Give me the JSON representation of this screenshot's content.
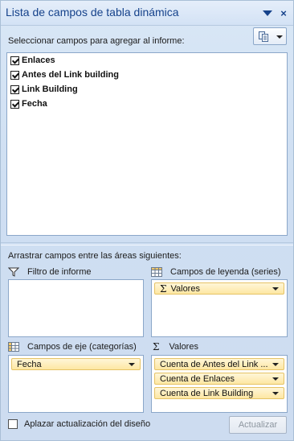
{
  "title": "Lista de campos de tabla dinámica",
  "select_prompt": "Seleccionar campos para agregar al informe:",
  "fields": [
    {
      "label": "Enlaces",
      "checked": true
    },
    {
      "label": "Antes del Link building",
      "checked": true
    },
    {
      "label": "Link Building",
      "checked": true
    },
    {
      "label": "Fecha",
      "checked": true
    }
  ],
  "drag_prompt": "Arrastrar campos entre las áreas siguientes:",
  "areas": {
    "report_filter": {
      "label": "Filtro de informe",
      "items": []
    },
    "legend_fields": {
      "label": "Campos de leyenda (series)",
      "items": [
        "Valores"
      ]
    },
    "axis_fields": {
      "label": "Campos de eje (categorías)",
      "items": [
        "Fecha"
      ]
    },
    "values": {
      "label": "Valores",
      "items": [
        "Cuenta de Antes del Link ...",
        "Cuenta de Enlaces",
        "Cuenta de Link Building"
      ]
    }
  },
  "defer_update": {
    "label": "Aplazar actualización del diseño",
    "checked": false
  },
  "update_button": "Actualizar",
  "icons": {
    "menu": "triangle-down",
    "close": "×",
    "filter": "funnel",
    "legend": "grid-table",
    "axis": "grid-table",
    "values": "Σ"
  },
  "colors": {
    "title_text": "#15428b",
    "chip_fill": "#fde7a3",
    "chip_border": "#e5c365",
    "pane_bg": "#d3e2f5"
  }
}
